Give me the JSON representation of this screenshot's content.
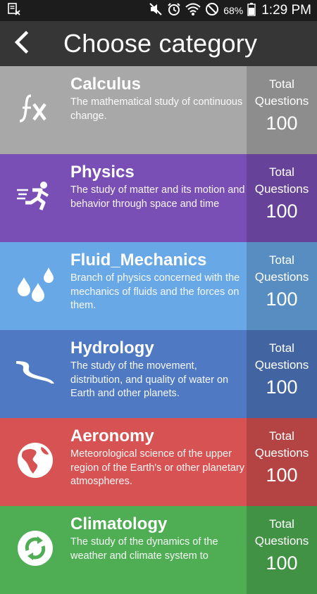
{
  "status_bar": {
    "battery": "68%",
    "time": "1:29 PM"
  },
  "header": {
    "title": "Choose category"
  },
  "categories": [
    {
      "name": "Calculus",
      "description": "The mathematical study of continuous change.",
      "count_label": "Total Questions",
      "count": "100",
      "color": "#a8a8a8",
      "icon": "function-icon"
    },
    {
      "name": "Physics",
      "description": "The study of matter and its motion and behavior through space and time",
      "count_label": "Total Questions",
      "count": "100",
      "color": "#7a4fb5",
      "icon": "runner-icon"
    },
    {
      "name": "Fluid_Mechanics",
      "description": "Branch of physics concerned with the mechanics of fluids and the forces on them.",
      "count_label": "Total Questions",
      "count": "100",
      "color": "#68a8e6",
      "icon": "droplets-icon"
    },
    {
      "name": "Hydrology",
      "description": "The study of the movement, distribution, and quality of water on Earth and other planets.",
      "count_label": "Total Questions",
      "count": "100",
      "color": "#4f79c2",
      "icon": "river-icon"
    },
    {
      "name": "Aeronomy",
      "description": "Meteorological science of the upper region of the Earth's or other planetary atmospheres.",
      "count_label": "Total Questions",
      "count": "100",
      "color": "#d75252",
      "icon": "globe-icon"
    },
    {
      "name": "Climatology",
      "description": "The study of the dynamics of the weather and climate system to",
      "count_label": "Total Questions",
      "count": "100",
      "color": "#4fae54",
      "icon": "recycle-icon"
    }
  ]
}
